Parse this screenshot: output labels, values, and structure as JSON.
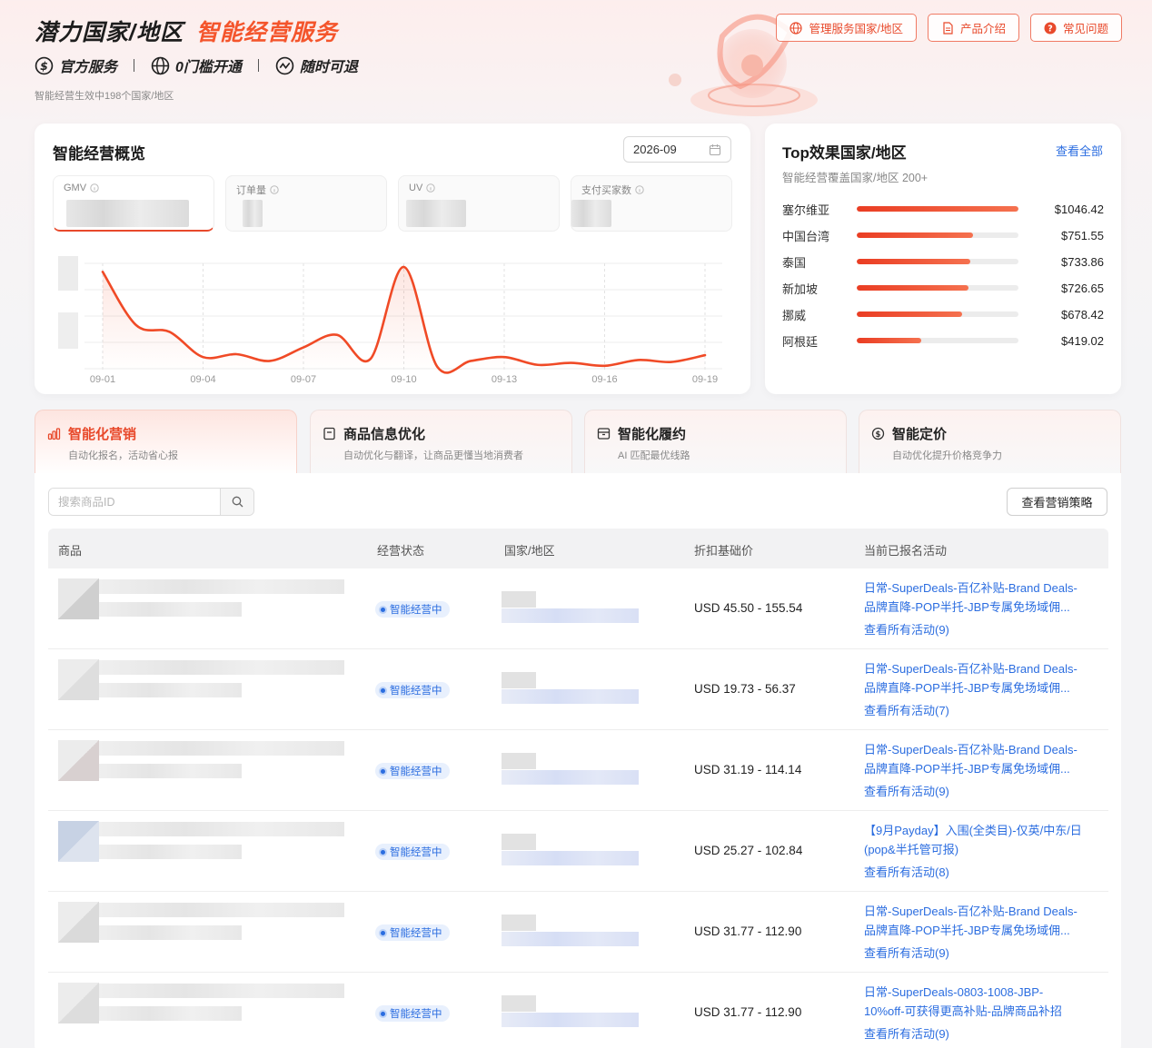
{
  "header": {
    "title_main": "潜力国家/地区",
    "title_accent": "智能经营服务",
    "features": [
      "官方服务",
      "0门槛开通",
      "随时可退"
    ],
    "note": "智能经营生效中198个国家/地区",
    "buttons": [
      "管理服务国家/地区",
      "产品介绍",
      "常见问题"
    ]
  },
  "overview": {
    "title": "智能经营概览",
    "date": "2026-09",
    "metrics": [
      "GMV",
      "订单量",
      "UV",
      "支付买家数"
    ]
  },
  "chart_data": {
    "type": "line",
    "title": "",
    "x": [
      "09-01",
      "09-02",
      "09-03",
      "09-04",
      "09-05",
      "09-06",
      "09-07",
      "09-08",
      "09-09",
      "09-10",
      "09-11",
      "09-12",
      "09-13",
      "09-14",
      "09-15",
      "09-16",
      "09-17",
      "09-18",
      "09-19"
    ],
    "x_tick_labels": [
      "09-01",
      "09-04",
      "09-07",
      "09-10",
      "09-13",
      "09-16",
      "09-19"
    ],
    "values": [
      100,
      45,
      38,
      12,
      15,
      8,
      22,
      35,
      10,
      105,
      2,
      8,
      12,
      4,
      6,
      3,
      9,
      7,
      14
    ],
    "ylim": [
      0,
      120
    ],
    "grid": true,
    "series_color": "#f04a26"
  },
  "top_regions": {
    "title": "Top效果国家/地区",
    "view_all": "查看全部",
    "subtitle": "智能经营覆盖国家/地区 200+",
    "items": [
      {
        "name": "塞尔维亚",
        "value": "$1046.42",
        "ratio": 1.0
      },
      {
        "name": "中国台湾",
        "value": "$751.55",
        "ratio": 0.72
      },
      {
        "name": "泰国",
        "value": "$733.86",
        "ratio": 0.7
      },
      {
        "name": "新加坡",
        "value": "$726.65",
        "ratio": 0.69
      },
      {
        "name": "挪威",
        "value": "$678.42",
        "ratio": 0.65
      },
      {
        "name": "阿根廷",
        "value": "$419.02",
        "ratio": 0.4
      }
    ]
  },
  "tabs": [
    {
      "title": "智能化营销",
      "desc": "自动化报名，活动省心报",
      "icon": "chart-bars-icon"
    },
    {
      "title": "商品信息优化",
      "desc": "自动优化与翻译，让商品更懂当地消费者",
      "icon": "document-icon"
    },
    {
      "title": "智能化履约",
      "desc": "AI 匹配最优线路",
      "icon": "box-icon"
    },
    {
      "title": "智能定价",
      "desc": "自动优化提升价格竞争力",
      "icon": "price-tag-icon"
    }
  ],
  "table": {
    "search_placeholder": "搜索商品ID",
    "strategy_button": "查看营销策略",
    "columns": [
      "商品",
      "经营状态",
      "国家/地区",
      "折扣基础价",
      "当前已报名活动"
    ],
    "rows": [
      {
        "status": "智能经营中",
        "price": "USD 45.50 - 155.54",
        "activity_line1": "日常-SuperDeals-百亿补贴-Brand Deals-",
        "activity_line2": "品牌直降-POP半托-JBP专属免场域佣...",
        "activity_link": "查看所有活动(9)"
      },
      {
        "status": "智能经营中",
        "price": "USD 19.73 - 56.37",
        "activity_line1": "日常-SuperDeals-百亿补贴-Brand Deals-",
        "activity_line2": "品牌直降-POP半托-JBP专属免场域佣...",
        "activity_link": "查看所有活动(7)"
      },
      {
        "status": "智能经营中",
        "price": "USD 31.19 - 114.14",
        "activity_line1": "日常-SuperDeals-百亿补贴-Brand Deals-",
        "activity_line2": "品牌直降-POP半托-JBP专属免场域佣...",
        "activity_link": "查看所有活动(9)"
      },
      {
        "status": "智能经营中",
        "price": "USD 25.27 - 102.84",
        "activity_line1": "【9月Payday】入围(全类目)-仅英/中东/日",
        "activity_line2": "(pop&半托管可报)",
        "activity_link": "查看所有活动(8)"
      },
      {
        "status": "智能经营中",
        "price": "USD 31.77 - 112.90",
        "activity_line1": "日常-SuperDeals-百亿补贴-Brand Deals-",
        "activity_line2": "品牌直降-POP半托-JBP专属免场域佣...",
        "activity_link": "查看所有活动(9)"
      },
      {
        "status": "智能经营中",
        "price": "USD 31.77 - 112.90",
        "activity_line1": "日常-SuperDeals-0803-1008-JBP-",
        "activity_line2": "10%off-可获得更高补贴-品牌商品补招",
        "activity_link": "查看所有活动(9)"
      }
    ]
  },
  "colors": {
    "accent": "#f4552c",
    "link": "#2b6de0",
    "status_bg": "#e8f0fd"
  }
}
